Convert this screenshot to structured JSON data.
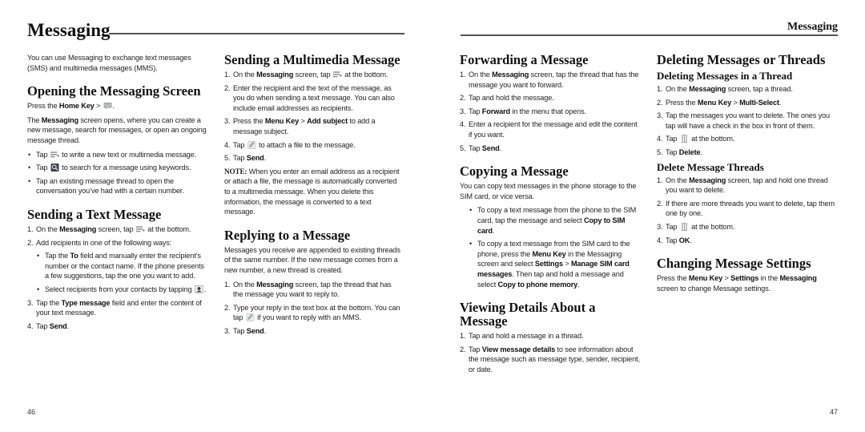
{
  "header": {
    "title": "Messaging",
    "running_head": "Messaging"
  },
  "footer": {
    "left_page_number": "46",
    "right_page_number": "47"
  },
  "icons": {
    "compose": "compose-message-icon",
    "search": "search-icon",
    "messaging_app": "messaging-app-icon",
    "contact": "contact-person-icon",
    "attach": "attach-paperclip-icon",
    "trash": "trash-can-icon"
  },
  "columns": [
    {
      "sections": [
        {
          "type": "para",
          "text": [
            [
              "You can use Messaging to exchange text messages (SMS) and multimedia messages (MMS)."
            ]
          ]
        },
        {
          "type": "heading",
          "text": "Opening the Messaging Screen"
        },
        {
          "type": "para",
          "text": [
            [
              "Press the "
            ],
            [
              "Home Key",
              "b"
            ],
            [
              " > "
            ],
            [
              "messaging_app",
              "icon"
            ],
            [
              "."
            ]
          ]
        },
        {
          "type": "para",
          "text": [
            [
              "The "
            ],
            [
              "Messaging",
              "b"
            ],
            [
              " screen opens, where you can create a new message, search for messages, or open an ongoing message thread."
            ]
          ]
        },
        {
          "type": "bullets",
          "items": [
            [
              [
                "Tap "
              ],
              [
                "compose",
                "icon"
              ],
              [
                " to write a new text or multimedia message."
              ]
            ],
            [
              [
                "Tap "
              ],
              [
                "search",
                "icon"
              ],
              [
                " to search for a message using keywords."
              ]
            ],
            [
              [
                "Tap an existing message thread to open the conversation you’ve had with a certain number."
              ]
            ]
          ]
        },
        {
          "type": "heading",
          "text": "Sending a Text Message"
        },
        {
          "type": "steps",
          "items": [
            {
              "num": "1.",
              "text": [
                [
                  "On the "
                ],
                [
                  "Messaging",
                  "b"
                ],
                [
                  " screen, tap "
                ],
                [
                  "compose",
                  "icon"
                ],
                [
                  " at the bottom."
                ]
              ]
            },
            {
              "num": "2.",
              "text": [
                [
                  "Add recipients in one of the following ways:"
                ]
              ],
              "bullets": [
                [
                  [
                    "Tap the "
                  ],
                  [
                    "To",
                    "b"
                  ],
                  [
                    " field and manually enter the recipient’s number or the contact name. If the phone presents a few suggestions, tap the one you want to add."
                  ]
                ],
                [
                  [
                    "Select recipients from your contacts by tapping "
                  ],
                  [
                    "contact",
                    "icon"
                  ],
                  [
                    "."
                  ]
                ]
              ]
            },
            {
              "num": "3.",
              "text": [
                [
                  "Tap the "
                ],
                [
                  "Type message",
                  "b"
                ],
                [
                  " field and enter the content of your text message."
                ]
              ]
            },
            {
              "num": "4.",
              "text": [
                [
                  "Tap "
                ],
                [
                  "Send",
                  "b"
                ],
                [
                  "."
                ]
              ]
            }
          ]
        }
      ]
    },
    {
      "sections": [
        {
          "type": "heading",
          "text": "Sending a Multimedia Message"
        },
        {
          "type": "steps",
          "items": [
            {
              "num": "1.",
              "text": [
                [
                  "On the "
                ],
                [
                  "Messaging",
                  "b"
                ],
                [
                  " screen, tap "
                ],
                [
                  "compose",
                  "icon"
                ],
                [
                  " at the bottom."
                ]
              ]
            },
            {
              "num": "2.",
              "text": [
                [
                  "Enter the recipient and the text of the message, as you do when sending a text message. You can also include email addresses as recipients."
                ]
              ]
            },
            {
              "num": "3.",
              "text": [
                [
                  "Press the "
                ],
                [
                  "Menu Key",
                  "b"
                ],
                [
                  " > "
                ],
                [
                  "Add subject",
                  "b"
                ],
                [
                  " to add a message subject."
                ]
              ]
            },
            {
              "num": "4.",
              "text": [
                [
                  "Tap "
                ],
                [
                  "attach",
                  "icon"
                ],
                [
                  " to attach a file to the message."
                ]
              ]
            },
            {
              "num": "5.",
              "text": [
                [
                  "Tap "
                ],
                [
                  "Send",
                  "b"
                ],
                [
                  "."
                ]
              ]
            }
          ]
        },
        {
          "type": "para",
          "text": [
            [
              "NOTE:",
              "note"
            ],
            [
              " When you enter an email address as a recipient or attach a file, the message is automatically converted to a multimedia message. When you delete this information, the message is converted to a text message."
            ]
          ]
        },
        {
          "type": "heading",
          "text": "Replying to a Message"
        },
        {
          "type": "para",
          "text": [
            [
              "Messages you receive are appended to existing threads of the same number. If the new message comes from a new number, a new thread is created."
            ]
          ]
        },
        {
          "type": "steps",
          "items": [
            {
              "num": "1.",
              "text": [
                [
                  "On the "
                ],
                [
                  "Messaging",
                  "b"
                ],
                [
                  " screen, tap the thread that has the message you want to reply to."
                ]
              ]
            },
            {
              "num": "2.",
              "text": [
                [
                  "Type your reply in the text box at the bottom. You can tap "
                ],
                [
                  "attach",
                  "icon"
                ],
                [
                  " if you want to reply with an MMS."
                ]
              ]
            },
            {
              "num": "3.",
              "text": [
                [
                  "Tap "
                ],
                [
                  "Send",
                  "b"
                ],
                [
                  "."
                ]
              ]
            }
          ]
        }
      ]
    },
    {
      "sections": [
        {
          "type": "heading",
          "text": "Forwarding a Message"
        },
        {
          "type": "steps",
          "items": [
            {
              "num": "1.",
              "text": [
                [
                  "On the "
                ],
                [
                  "Messaging",
                  "b"
                ],
                [
                  " screen, tap the thread that has the message you want to forward."
                ]
              ]
            },
            {
              "num": "2.",
              "text": [
                [
                  "Tap and hold the message."
                ]
              ]
            },
            {
              "num": "3.",
              "text": [
                [
                  "Tap "
                ],
                [
                  "Forward",
                  "b"
                ],
                [
                  " in the menu that opens."
                ]
              ]
            },
            {
              "num": "4.",
              "text": [
                [
                  "Enter a recipient for the message and edit the content if you want."
                ]
              ]
            },
            {
              "num": "5.",
              "text": [
                [
                  "Tap "
                ],
                [
                  "Send",
                  "b"
                ],
                [
                  "."
                ]
              ]
            }
          ]
        },
        {
          "type": "heading",
          "text": "Copying a Message"
        },
        {
          "type": "para",
          "text": [
            [
              "You can copy text messages in the phone storage to the SIM card, or vice versa."
            ]
          ]
        },
        {
          "type": "bullets",
          "indent": true,
          "items": [
            [
              [
                "To copy a text message from the phone to the SIM card, tap the message and select "
              ],
              [
                "Copy to SIM card",
                "b"
              ],
              [
                "."
              ]
            ],
            [
              [
                "To copy a text message from the SIM card to the phone, press the "
              ],
              [
                "Menu Key",
                "b"
              ],
              [
                " in the Messaging screen and select "
              ],
              [
                "Settings",
                "b"
              ],
              [
                " > "
              ],
              [
                "Manage SIM card messages",
                "b"
              ],
              [
                ". Then tap and hold a message and select "
              ],
              [
                "Copy to phone memory",
                "b"
              ],
              [
                "."
              ]
            ]
          ]
        },
        {
          "type": "heading",
          "text": "Viewing Details About a Message"
        },
        {
          "type": "steps",
          "items": [
            {
              "num": "1.",
              "text": [
                [
                  "Tap and hold a message in a thread."
                ]
              ]
            },
            {
              "num": "2.",
              "text": [
                [
                  "Tap "
                ],
                [
                  "View message details",
                  "b"
                ],
                [
                  " to see information about the message such as message type, sender, recipient, or date."
                ]
              ]
            }
          ]
        }
      ]
    },
    {
      "sections": [
        {
          "type": "heading",
          "text": "Deleting Messages or Threads"
        },
        {
          "type": "subheading",
          "text": "Deleting Messages in a Thread"
        },
        {
          "type": "steps",
          "items": [
            {
              "num": "1.",
              "text": [
                [
                  "On the "
                ],
                [
                  "Messaging",
                  "b"
                ],
                [
                  " screen, tap a thread."
                ]
              ]
            },
            {
              "num": "2.",
              "text": [
                [
                  "Press the "
                ],
                [
                  "Menu Key",
                  "b"
                ],
                [
                  " > "
                ],
                [
                  "Multi-Select",
                  "b"
                ],
                [
                  "."
                ]
              ]
            },
            {
              "num": "3.",
              "text": [
                [
                  "Tap the messages you want to delete. The ones you tap will have a check in the box in front of them."
                ]
              ]
            },
            {
              "num": "4.",
              "text": [
                [
                  "Tap "
                ],
                [
                  "trash",
                  "icon"
                ],
                [
                  " at the bottom."
                ]
              ]
            },
            {
              "num": "5.",
              "text": [
                [
                  "Tap "
                ],
                [
                  "Delete",
                  "b"
                ],
                [
                  "."
                ]
              ]
            }
          ]
        },
        {
          "type": "subheading",
          "text": "Delete Message Threads"
        },
        {
          "type": "steps",
          "items": [
            {
              "num": "1.",
              "text": [
                [
                  "On the "
                ],
                [
                  "Messaging",
                  "b"
                ],
                [
                  " screen, tap and hold one thread you want to delete."
                ]
              ]
            },
            {
              "num": "2.",
              "text": [
                [
                  "If there are more threads you want to delete, tap them one by one."
                ]
              ]
            },
            {
              "num": "3.",
              "text": [
                [
                  "Tap "
                ],
                [
                  "trash",
                  "icon"
                ],
                [
                  " at the bottom."
                ]
              ]
            },
            {
              "num": "4.",
              "text": [
                [
                  "Tap "
                ],
                [
                  "OK",
                  "b"
                ],
                [
                  "."
                ]
              ]
            }
          ]
        },
        {
          "type": "heading",
          "text": "Changing Message Settings"
        },
        {
          "type": "para",
          "text": [
            [
              "Press the "
            ],
            [
              "Menu Key",
              "b"
            ],
            [
              " > "
            ],
            [
              "Settings",
              "b"
            ],
            [
              " in the "
            ],
            [
              "Messaging",
              "b"
            ],
            [
              " screen to change Message settings."
            ]
          ]
        }
      ]
    }
  ]
}
